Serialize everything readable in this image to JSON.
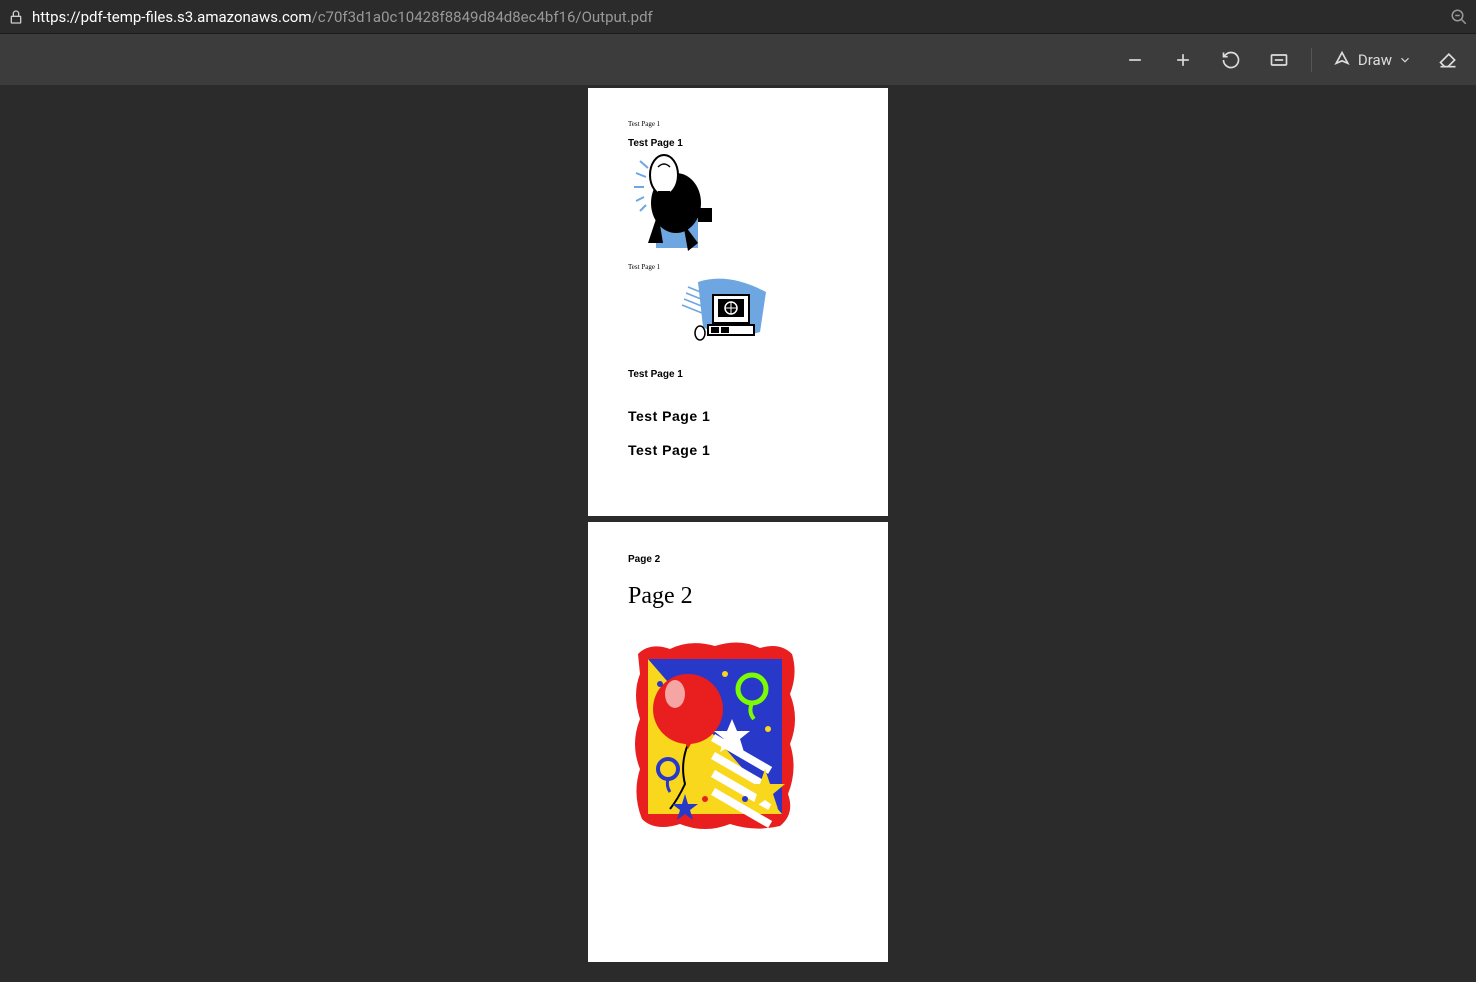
{
  "address_bar": {
    "url_domain": "https://pdf-temp-files.s3.amazonaws.com",
    "url_path": "/c70f3d1a0c10428f8849d84d8ec4bf16/Output.pdf"
  },
  "toolbar": {
    "draw_label": "Draw"
  },
  "pdf": {
    "page1": {
      "tiny1": "Test Page 1",
      "bold1": "Test Page 1",
      "tiny2": "Test Page 1",
      "bold2": "Test Page 1",
      "large1": "Test Page 1",
      "large2": "Test Page 1"
    },
    "page2": {
      "small": "Page 2",
      "large": "Page 2"
    }
  }
}
